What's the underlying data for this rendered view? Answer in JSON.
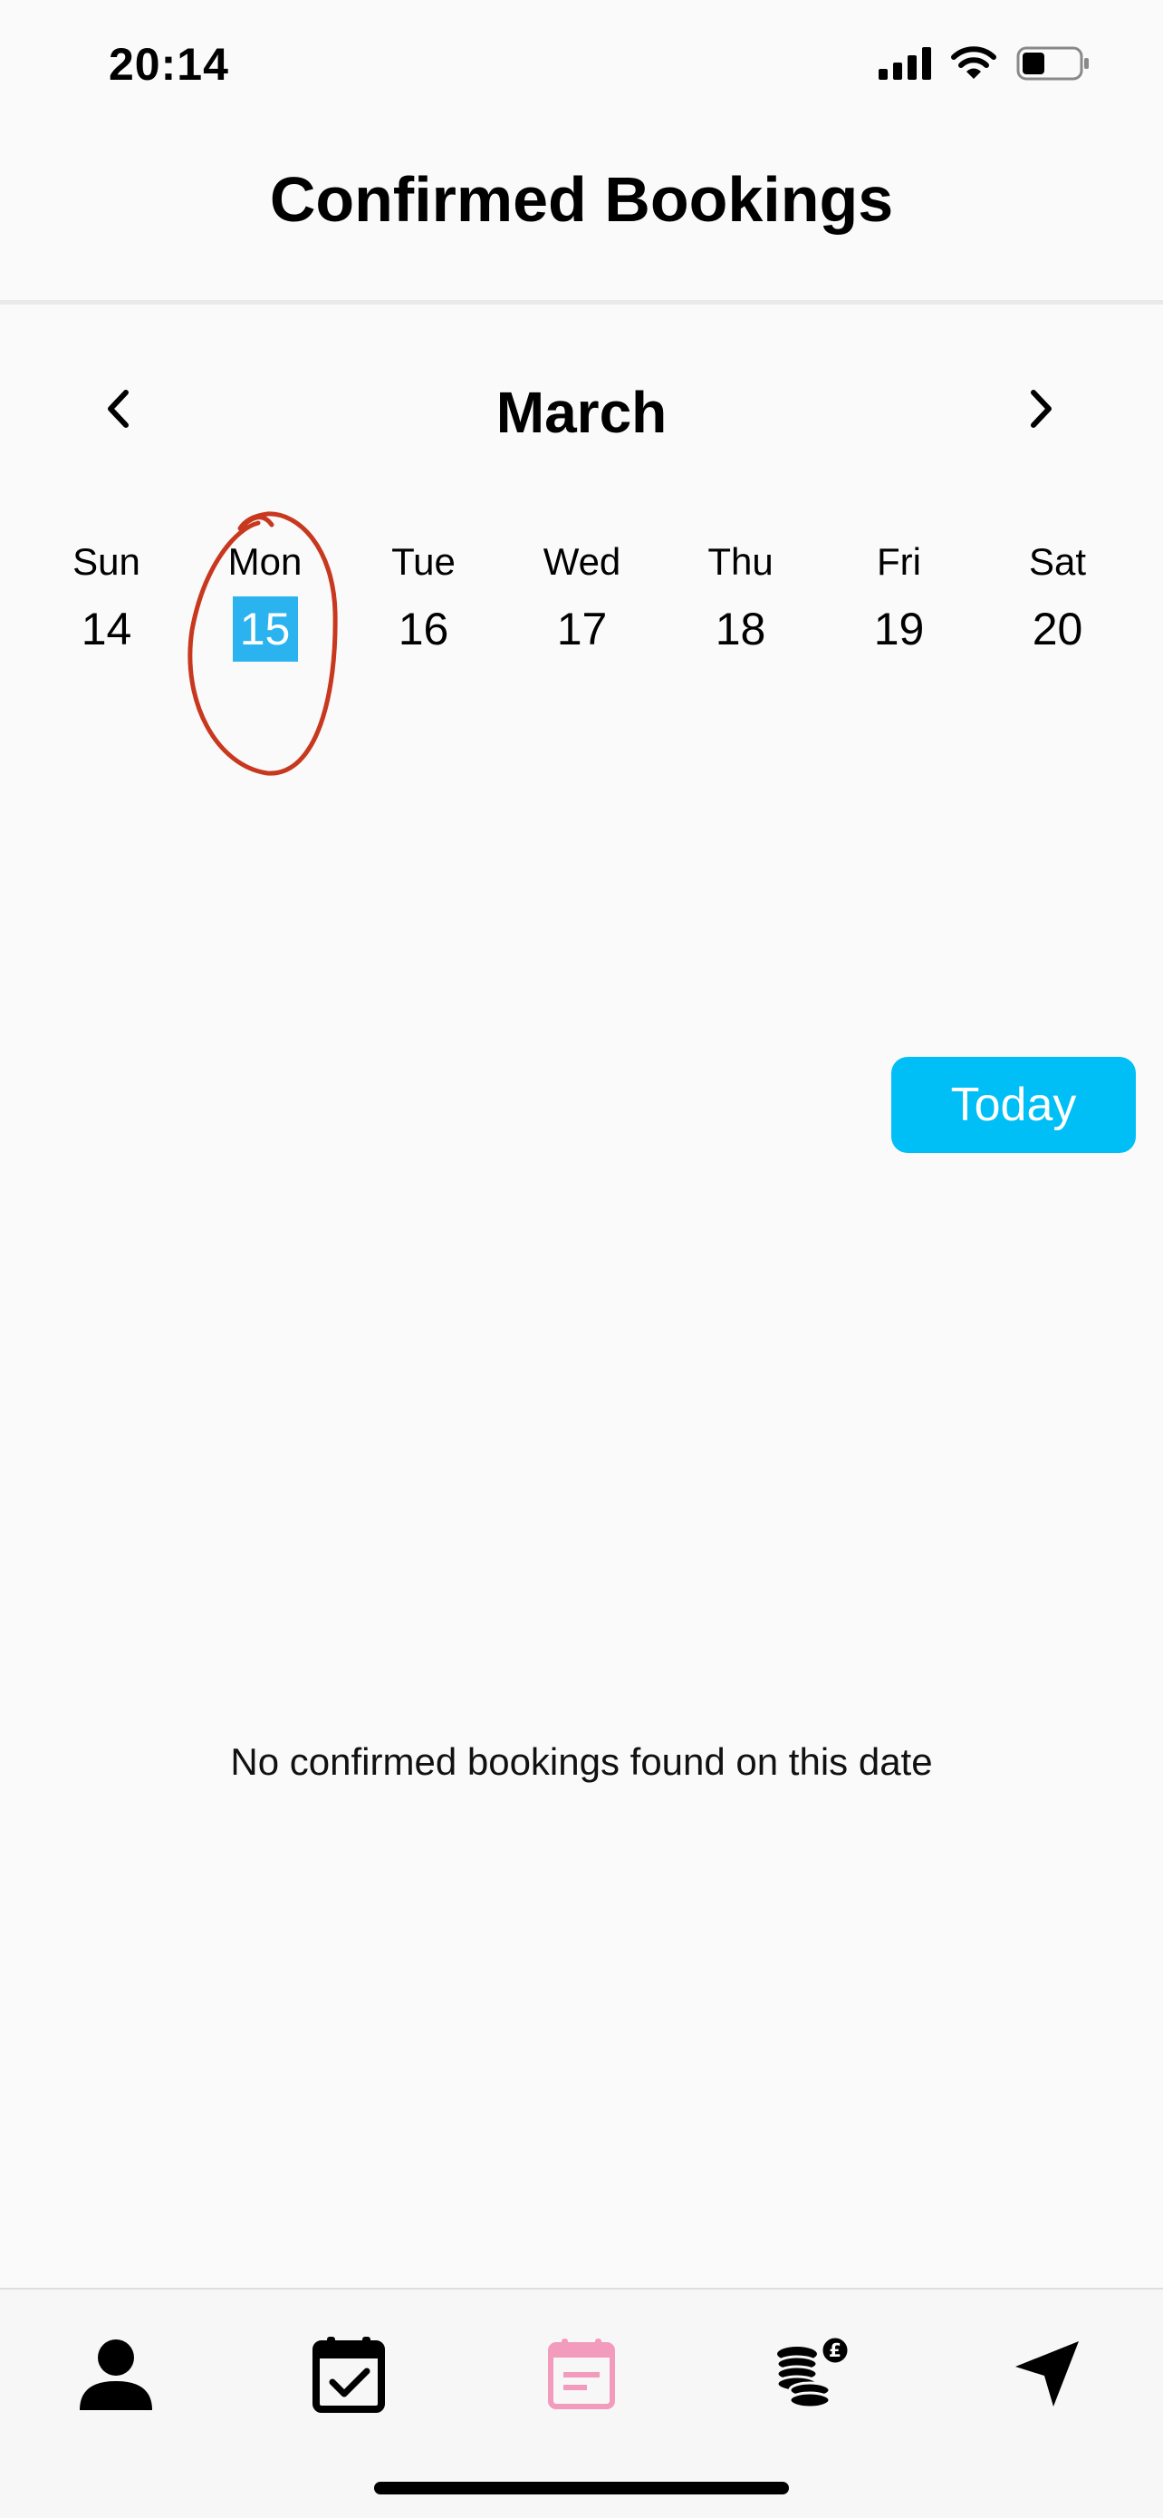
{
  "status_bar": {
    "time": "20:14"
  },
  "header": {
    "title": "Confirmed Bookings"
  },
  "calendar": {
    "month": "March",
    "days": [
      {
        "name": "Sun",
        "number": "14"
      },
      {
        "name": "Mon",
        "number": "15"
      },
      {
        "name": "Tue",
        "number": "16"
      },
      {
        "name": "Wed",
        "number": "17"
      },
      {
        "name": "Thu",
        "number": "18"
      },
      {
        "name": "Fri",
        "number": "19"
      },
      {
        "name": "Sat",
        "number": "20"
      }
    ],
    "selected_index": 1
  },
  "today_button": {
    "label": "Today"
  },
  "empty_state": {
    "message": "No confirmed bookings found on this date"
  },
  "tab_bar": {
    "items": [
      {
        "icon": "person-icon",
        "active": false
      },
      {
        "icon": "calendar-check-icon",
        "active": false
      },
      {
        "icon": "calendar-list-icon",
        "active": true
      },
      {
        "icon": "coins-pound-icon",
        "active": false
      },
      {
        "icon": "navigation-arrow-icon",
        "active": false
      }
    ]
  },
  "colors": {
    "selected_day": "#2bb3ef",
    "today_button": "#00bff6",
    "active_tab": "#f39bbd",
    "annotation": "#c8381f"
  }
}
